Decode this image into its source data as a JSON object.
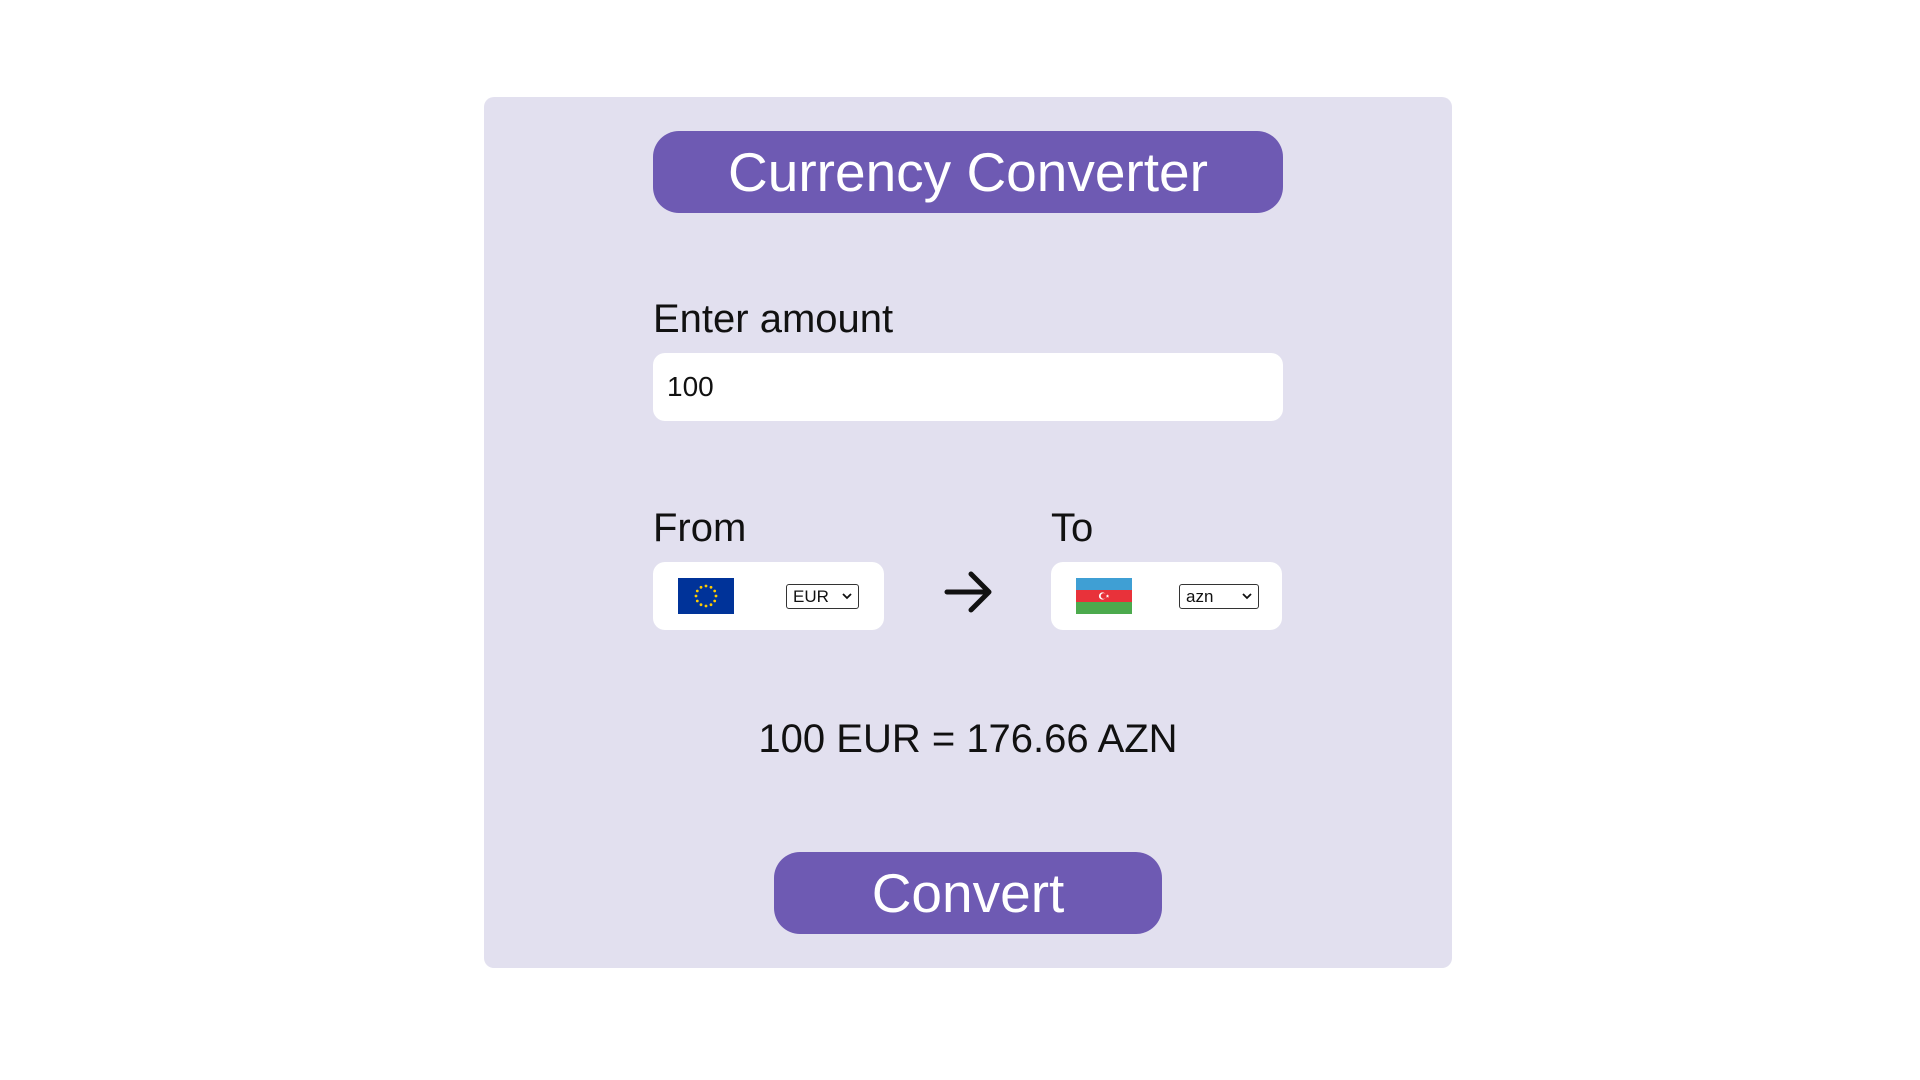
{
  "title": "Currency Converter",
  "amount": {
    "label": "Enter amount",
    "value": "100"
  },
  "from": {
    "label": "From",
    "currency": "EUR",
    "flag_icon": "eu-flag-icon"
  },
  "to": {
    "label": "To",
    "currency": "azn",
    "flag_icon": "azerbaijan-flag-icon"
  },
  "arrow_icon": "arrow-right-icon",
  "result": "100 EUR = 176.66 AZN",
  "convert_label": "Convert",
  "colors": {
    "accent": "#6e5ab3",
    "card_background": "#e2e0ef",
    "page_background": "#ffffff"
  }
}
